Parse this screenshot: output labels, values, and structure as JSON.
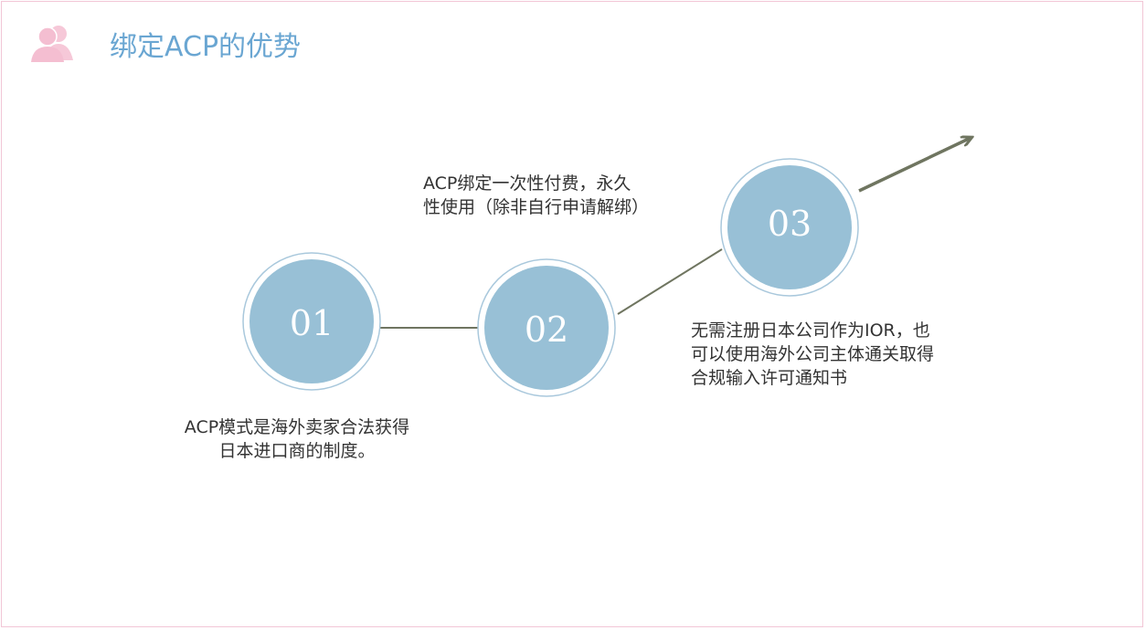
{
  "header": {
    "title": "绑定ACP的优势",
    "icon": "people-icon"
  },
  "colors": {
    "circle_fill": "#98c0d6",
    "circle_ring": "#a9c8dc",
    "connector": "#6f7560",
    "title": "#6aa6d2",
    "icon": "#f4bed1",
    "frame": "#f2c6d6"
  },
  "steps": [
    {
      "number": "01",
      "text_lines": [
        "ACP模式是海外卖家合法获得",
        "日本进口商的制度。"
      ]
    },
    {
      "number": "02",
      "text_lines": [
        "ACP绑定一次性付费，永久",
        "性使用（除非自行申请解绑）"
      ]
    },
    {
      "number": "03",
      "text_lines": [
        "无需注册日本公司作为IOR，也",
        "可以使用海外公司主体通关取得",
        "合规输入许可通知书"
      ]
    }
  ]
}
